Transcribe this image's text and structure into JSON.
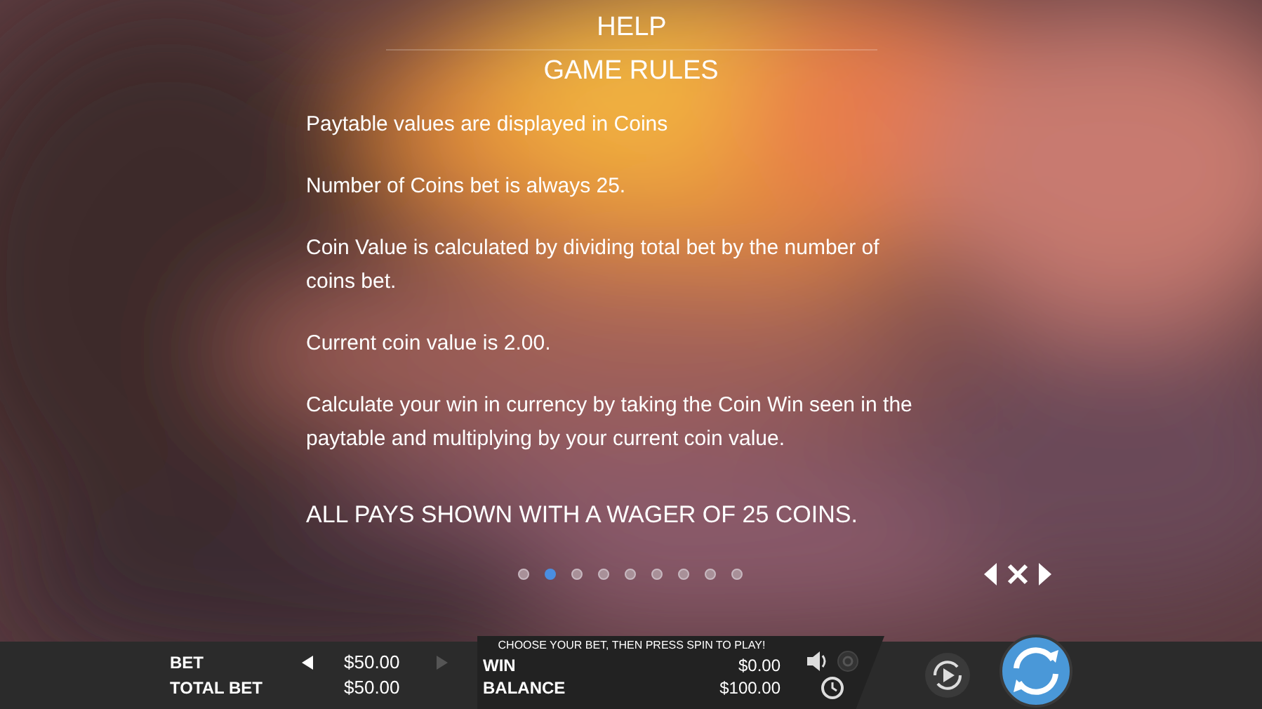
{
  "header": {
    "title": "HELP",
    "subtitle": "GAME RULES"
  },
  "paragraphs": [
    "Paytable values are displayed in Coins",
    "Number of Coins bet is always 25.",
    "Coin Value is calculated by dividing total bet by the number of coins bet.",
    "Current coin value is 2.00.",
    "Calculate your win in currency by taking the Coin Win seen in the paytable and multiplying by your current coin value."
  ],
  "emphasis": "ALL PAYS SHOWN WITH A WAGER OF 25 COINS.",
  "pages": [
    {
      "selected": false
    },
    {
      "selected": true
    },
    {
      "selected": false
    },
    {
      "selected": false
    },
    {
      "selected": false
    },
    {
      "selected": false
    },
    {
      "selected": false
    },
    {
      "selected": false
    },
    {
      "selected": false
    }
  ],
  "bar": {
    "message": "CHOOSE YOUR BET, THEN PRESS SPIN TO PLAY!",
    "bet": {
      "label": "BET",
      "value": "$50.00",
      "decrease_disabled": false,
      "increase_disabled": true
    },
    "total_bet": {
      "label": "TOTAL BET",
      "value": "$50.00"
    },
    "win": {
      "label": "WIN",
      "value": "$0.00"
    },
    "balance": {
      "label": "BALANCE",
      "value": "$100.00"
    }
  }
}
